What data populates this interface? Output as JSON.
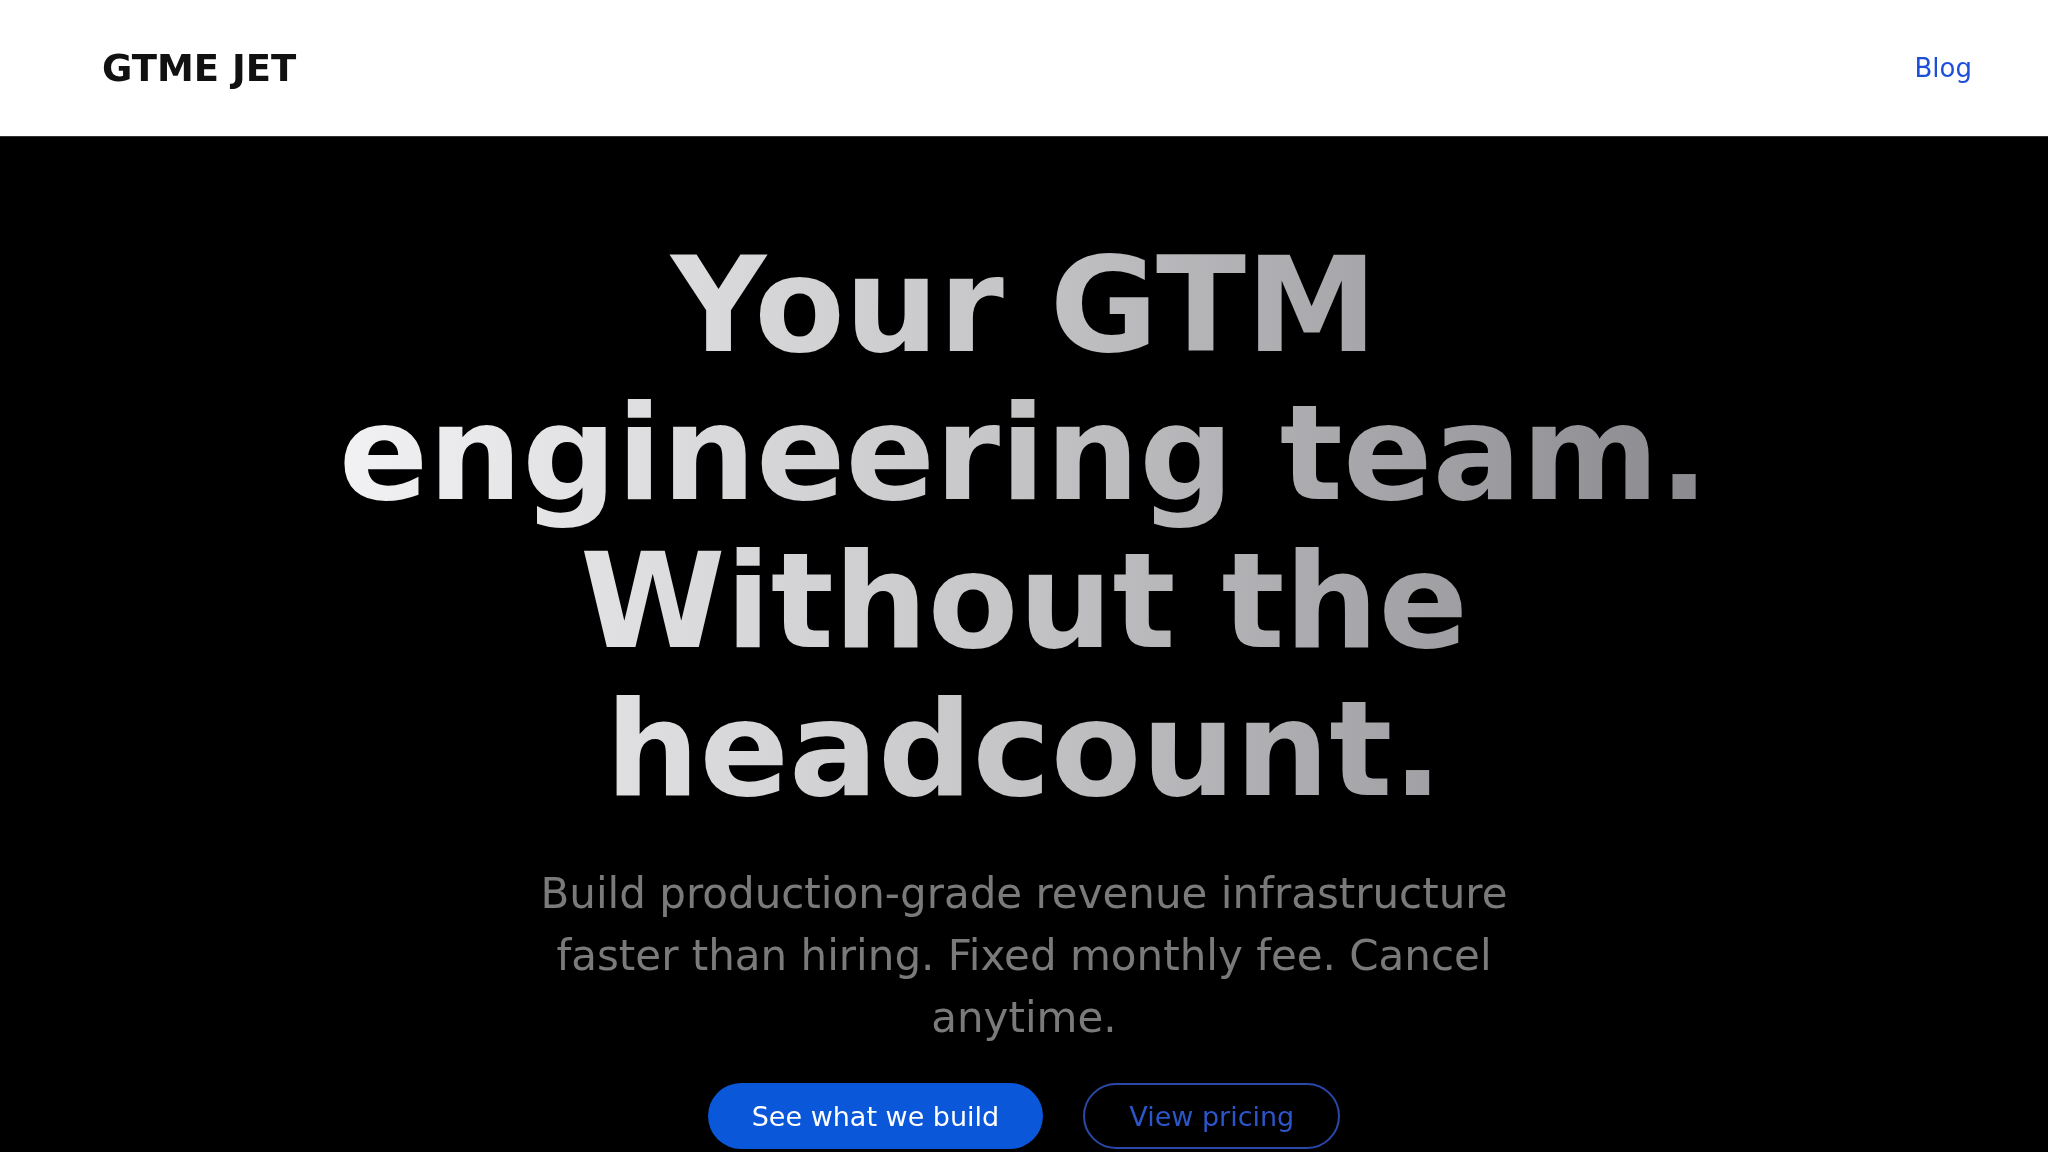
{
  "header": {
    "logo": "GTME JET",
    "nav": [
      {
        "label": "Blog"
      }
    ]
  },
  "hero": {
    "title_lines": [
      "Your GTM",
      "engineering team.",
      "Without the",
      "headcount."
    ],
    "subtitle": "Build production-grade revenue infrastructure faster than hiring. Fixed monthly fee. Cancel anytime.",
    "buttons": [
      {
        "label": "See what we build",
        "kind": "primary"
      },
      {
        "label": "View pricing",
        "kind": "secondary"
      }
    ]
  }
}
